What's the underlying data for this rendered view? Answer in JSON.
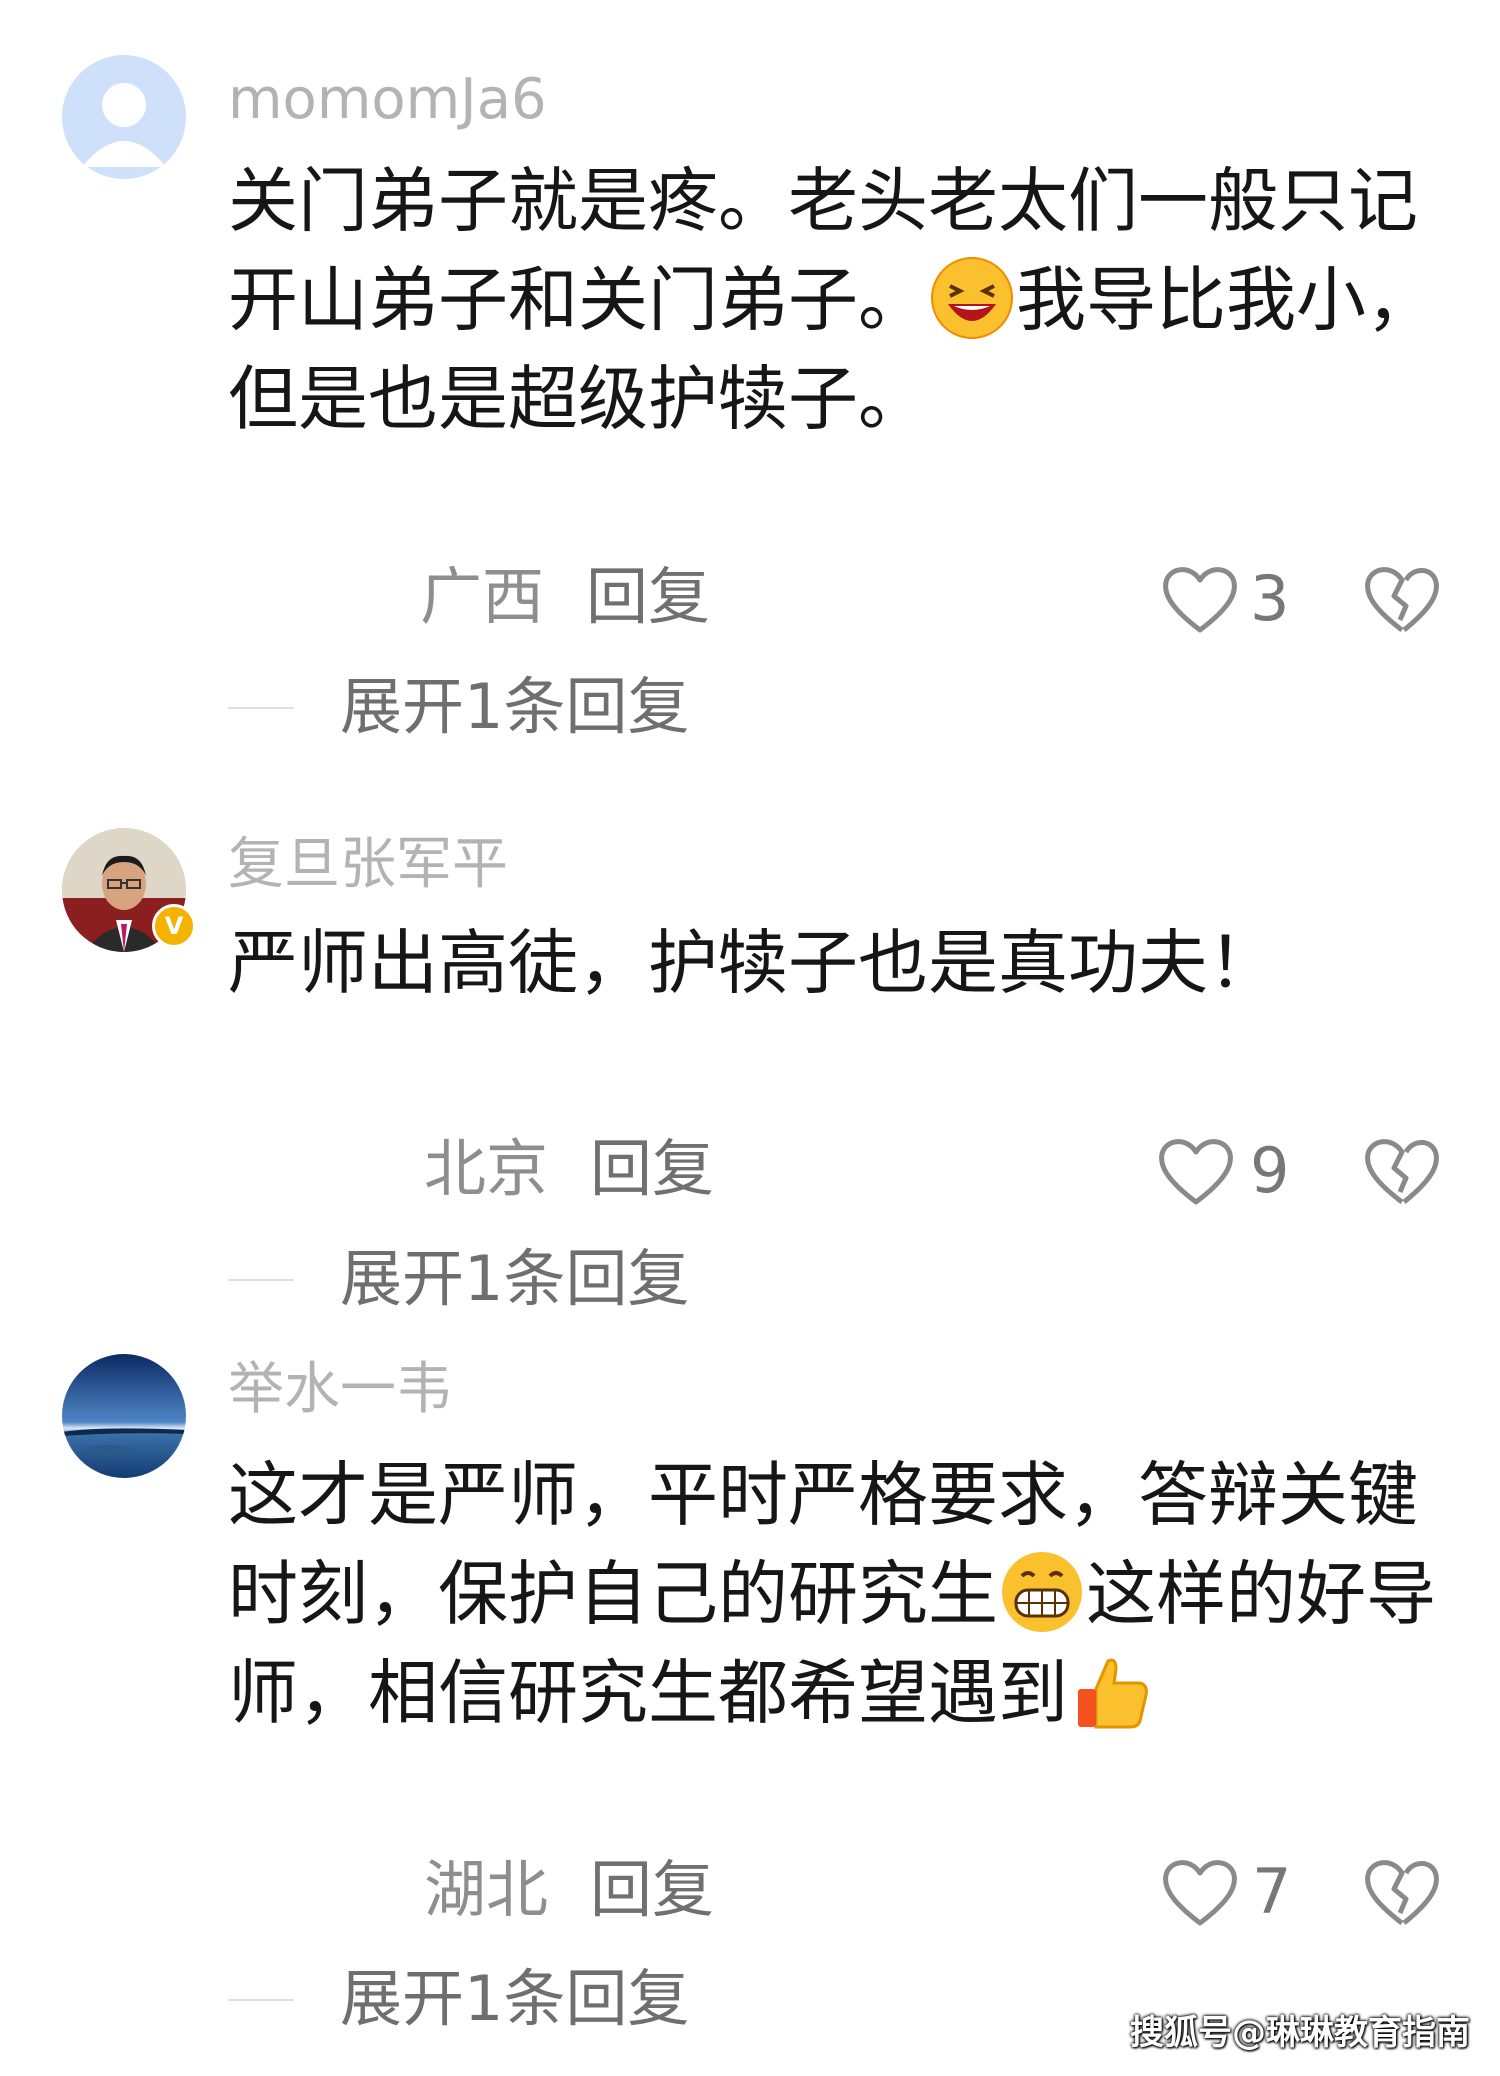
{
  "comments": [
    {
      "username": "momomJa6",
      "content_parts": [
        "关门弟子就是疼。老头老太们一般只记开山弟子和关门弟子。",
        "我导比我小，但是也是超级护犊子。"
      ],
      "emoji": "laughing-face-emoji",
      "location": "广西",
      "reply_label": "回复",
      "likes": "3",
      "expand_label": "展开1条回复"
    },
    {
      "username": "复旦张军平",
      "content": "严师出高徒，护犊子也是真功夫！",
      "verified_badge": "V",
      "location": "北京",
      "reply_label": "回复",
      "likes": "9",
      "expand_label": "展开1条回复"
    },
    {
      "username": "举水一韦",
      "content_parts": [
        "这才是严师，平时严格要求，答辩关键时刻，保护自己的研究生",
        "这样的好导师，相信研究生都希望遇到"
      ],
      "emojis": [
        "grinning-face-emoji",
        "thumbs-up-emoji"
      ],
      "location": "湖北",
      "reply_label": "回复",
      "likes": "7",
      "expand_label": "展开1条回复"
    }
  ],
  "watermark": "搜狐号@琳琳教育指南",
  "colors": {
    "username": "#b3b3b3",
    "content": "#161616",
    "meta": "#8e8e8e",
    "verified": "#f3b300"
  }
}
